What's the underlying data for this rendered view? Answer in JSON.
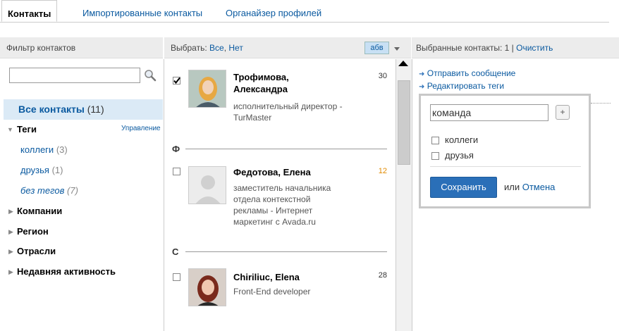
{
  "tabs": [
    "Контакты",
    "Импортированные контакты",
    "Органайзер профилей"
  ],
  "filter": {
    "header": "Фильтр контактов",
    "all_contacts": "Все контакты",
    "all_count": "(11)",
    "tags_label": "Теги",
    "manage": "Управление",
    "tags": [
      {
        "name": "коллеги",
        "count": "(3)"
      },
      {
        "name": "друзья",
        "count": "(1)"
      },
      {
        "name": "без тегов",
        "count": "(7)"
      }
    ],
    "sections": [
      "Компании",
      "Регион",
      "Отрасли",
      "Недавняя активность"
    ]
  },
  "list": {
    "select_label": "Выбрать:",
    "select_all": "Все",
    "select_none": "Нет",
    "sort_button": "абв",
    "contacts": [
      {
        "name_line1": "Трофимова,",
        "name_line2": "Александра",
        "desc": [
          "исполнительный директор -",
          "TurMaster"
        ],
        "count": "30",
        "checked": true
      },
      {
        "name_line1": "Федотова, Елена",
        "name_line2": "",
        "desc": [
          "заместитель начальника",
          "отдела контекстной",
          "рекламы - Интернет",
          "маркетинг с Avada.ru"
        ],
        "count": "12",
        "checked": false
      },
      {
        "name_line1": "Chiriliuc, Elena",
        "name_line2": "",
        "desc": [
          "Front-End developer"
        ],
        "count": "28",
        "checked": false
      }
    ],
    "letters": [
      "Ф",
      "C"
    ]
  },
  "selected": {
    "header_prefix": "Выбранные контакты: 1 |",
    "clear": "Очистить",
    "send_message": "Отправить сообщение",
    "edit_tags": "Редактировать теги"
  },
  "popup": {
    "input_value": "команда",
    "plus": "+",
    "tags": [
      "коллеги",
      "друзья"
    ],
    "save": "Сохранить",
    "or": "или",
    "cancel": "Отмена"
  },
  "colors": {
    "link": "#0b5aa0",
    "accent": "#2a6fb8",
    "count_orange": "#e08a00",
    "selected_bg": "#dbeaf6"
  }
}
